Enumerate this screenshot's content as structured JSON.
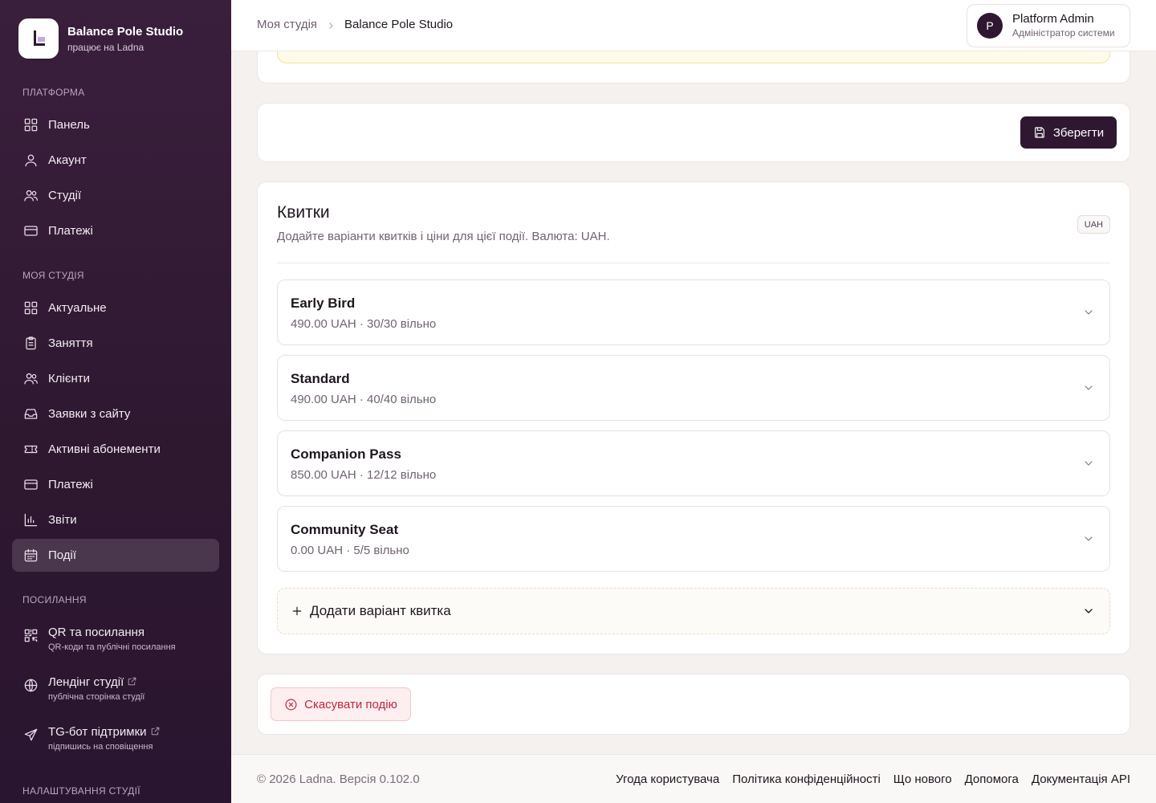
{
  "brand": {
    "name": "Balance Pole Studio",
    "subtitle": "працює на Ladna"
  },
  "sidebar": {
    "sections": {
      "platform": "ПЛАТФОРМА",
      "my_studio": "МОЯ СТУДІЯ",
      "links": "ПОСИЛАННЯ",
      "studio_settings": "НАЛАШТУВАННЯ СТУДІЇ"
    },
    "platform_items": [
      {
        "label": "Панель",
        "icon": "dashboard-icon"
      },
      {
        "label": "Акаунт",
        "icon": "user-icon"
      },
      {
        "label": "Студії",
        "icon": "users-icon"
      },
      {
        "label": "Платежі",
        "icon": "credit-card-icon"
      }
    ],
    "studio_items": [
      {
        "label": "Актуальне",
        "icon": "dashboard-icon"
      },
      {
        "label": "Заняття",
        "icon": "clipboard-icon"
      },
      {
        "label": "Клієнти",
        "icon": "users-icon"
      },
      {
        "label": "Заявки з сайту",
        "icon": "inbox-icon"
      },
      {
        "label": "Активні абонементи",
        "icon": "ticket-icon"
      },
      {
        "label": "Платежі",
        "icon": "credit-card-icon"
      },
      {
        "label": "Звіти",
        "icon": "bar-chart-icon"
      },
      {
        "label": "Події",
        "icon": "calendar-icon",
        "active": true
      }
    ],
    "link_items": [
      {
        "label": "QR та посилання",
        "sub": "QR-коди та публічні посилання",
        "icon": "qr-code-icon"
      },
      {
        "label": "Лендінг студії",
        "sub": "публічна сторінка студії",
        "icon": "globe-icon",
        "external": true
      },
      {
        "label": "TG-бот підтримки",
        "sub": "підпишись на сповіщення",
        "icon": "send-icon",
        "external": true
      }
    ]
  },
  "header": {
    "breadcrumb": [
      "Моя студія",
      "Balance Pole Studio"
    ],
    "user": {
      "initial": "P",
      "name": "Platform Admin",
      "role": "Адміністратор системи"
    }
  },
  "actions": {
    "save_label": "Зберегти"
  },
  "tickets": {
    "title": "Квитки",
    "description": "Додайте варіанти квитків і ціни для цієї події. Валюта: UAH.",
    "currency": "UAH",
    "items": [
      {
        "name": "Early Bird",
        "meta": "490.00 UAH · 30/30 вільно"
      },
      {
        "name": "Standard",
        "meta": "490.00 UAH · 40/40 вільно"
      },
      {
        "name": "Companion Pass",
        "meta": "850.00 UAH · 12/12 вільно"
      },
      {
        "name": "Community Seat",
        "meta": "0.00 UAH · 5/5 вільно"
      }
    ],
    "add_label": "Додати варіант квитка"
  },
  "cancel_event_label": "Скасувати подію",
  "footer": {
    "copyright": "© 2026 Ladna. Версія 0.102.0",
    "links": [
      "Угода користувача",
      "Політика конфіденційності",
      "Що нового",
      "Допомога",
      "Документація API"
    ]
  },
  "colors": {
    "sidebar_bg": "#2e1830",
    "primary": "#2f1731",
    "danger": "#c2263e",
    "warning_bg": "#fffbe8"
  }
}
